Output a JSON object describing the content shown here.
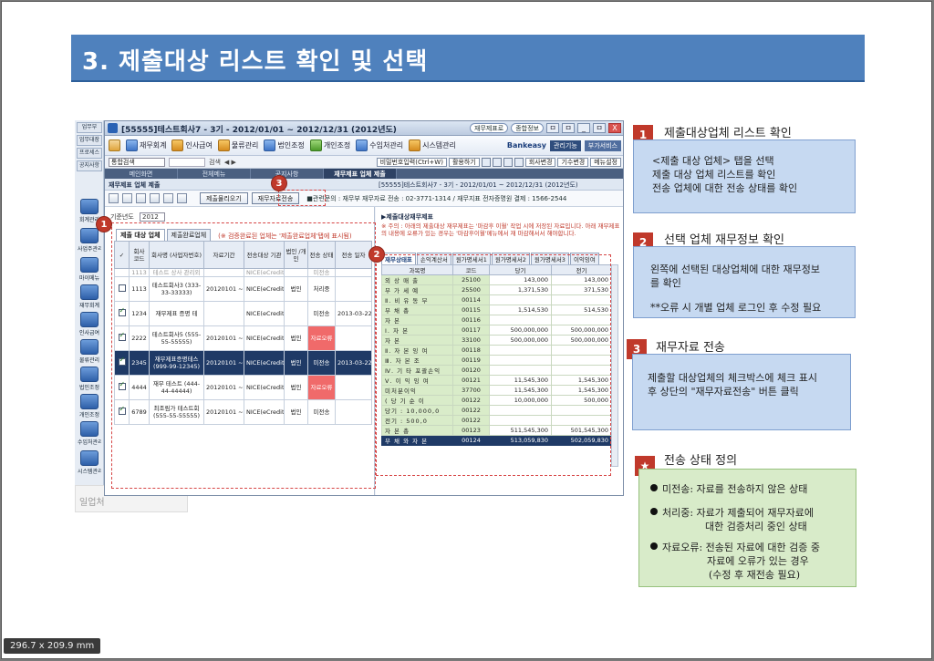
{
  "page_size_label": "296.7 x 209.9 mm",
  "title": "3. 제출대상 리스트 확인 및 선택",
  "app": {
    "window_title": "[55555]테스트회사7 - 3기 - 2012/01/01 ~ 2012/12/31 (2012년도)",
    "title_pills": [
      "재무제표로",
      "종합정보"
    ],
    "win_controls": [
      "ㅁ",
      "ㅁ",
      "_",
      "ㅁ",
      "X"
    ],
    "toolbar": {
      "items": [
        "재무회계",
        "인사급여",
        "물류관리",
        "법인조정",
        "개인조정",
        "수임처관리",
        "시스템관리"
      ],
      "brand": "Bankeasy",
      "drops": [
        "관리기능",
        "부가서비스"
      ]
    },
    "toolbar2": {
      "select_value": "통합검색",
      "search_label": "검색",
      "buttons": [
        "비밀번호입력(Ctrl+W)",
        "활용하기"
      ],
      "right_buttons": [
        "회사변경",
        "기수변경",
        "메뉴설정"
      ]
    },
    "menu_tabs": [
      "메인화면",
      "전체메뉴",
      "공지사항",
      "재무제표 업체 제출"
    ],
    "panel": {
      "title": "재무제표 업체 제출",
      "right_title": "[55555]테스트회사7 - 3기 - 2012/01/01 ~ 2012/12/31 (2012년도)"
    },
    "actions": {
      "btn_delete": "제출물리오기",
      "btn_send": "재무자료전송",
      "note": "■관련문의 : 재무부 재무자료 전송 : 02-3771-1314 / 재무지표 전자증명원 결제 : 1566-2544"
    },
    "left": {
      "year_label": "기준년도",
      "year_value": "2012",
      "tabs": [
        "제출 대상 업체",
        "제출완료업체"
      ],
      "tab_note": "(※ 검증완료된 업체는 '제출완료업체'탭에 표시됨)",
      "columns": [
        "✓",
        "회사 코드",
        "회사명 (사업자번호)",
        "자료기간",
        "전송대상 기관",
        "법인 /개인",
        "전송 상태",
        "전송 일자"
      ],
      "cut_row": [
        "",
        "1113",
        "테스트 상사 관리외",
        "",
        "NICE(eCredit",
        "",
        "미전송",
        ""
      ],
      "rows": [
        {
          "checked": false,
          "code": "1113",
          "name": "테스트회사3 (333-33-33333)",
          "period": "20120101 ~20121231",
          "agency": "NICE(eCredit",
          "type": "법인",
          "status": "처리중",
          "date": "",
          "status_err": false,
          "selected": false
        },
        {
          "checked": true,
          "code": "1234",
          "name": "재무제표 증명 테",
          "period": "",
          "agency": "NICE(eCredit",
          "type": "",
          "status": "미전송",
          "date": "2013-03-22",
          "status_err": false,
          "selected": false
        },
        {
          "checked": true,
          "code": "2222",
          "name": "테스트회사5 (555-55-55555)",
          "period": "20120101 ~20121231",
          "agency": "NICE(eCredit",
          "type": "법인",
          "status": "자료오류",
          "date": "",
          "status_err": true,
          "selected": false
        },
        {
          "checked": true,
          "code": "2345",
          "name": "재무제표증명테스 (999-99-12345)",
          "period": "20120101 ~20121231",
          "agency": "NICE(eCredit",
          "type": "법인",
          "status": "미전송",
          "date": "2013-03-22",
          "status_err": false,
          "selected": true
        },
        {
          "checked": true,
          "code": "4444",
          "name": "재무 테스트 (444-44-44444)",
          "period": "20120101 ~20121231",
          "agency": "NICE(eCredit",
          "type": "법인",
          "status": "자료오류",
          "date": "",
          "status_err": true,
          "selected": false
        },
        {
          "checked": true,
          "code": "6789",
          "name": "최조림가 테스트회 (555-55-55555)",
          "period": "20120101 ~20121231",
          "agency": "NICE(eCredit",
          "type": "법인",
          "status": "미전송",
          "date": "",
          "status_err": false,
          "selected": false
        }
      ]
    },
    "right": {
      "title": "▶제출대상재무제표",
      "note": "※ 주의 : 아래의 제출대상 재무제표는 '마감후 이월' 작업 시에 저장된 자료입니다. 아래 재무제표의 내용에 오류가 있는 경우는 '마감후이월'메뉴에서 재 마감해서서 해야합니다.",
      "tabs": [
        "재무상태표",
        "손익계산서",
        "원가명세서1",
        "원가명세서2",
        "원가명세서3",
        "이익잉여"
      ],
      "columns": [
        "과목명",
        "코드",
        "당기",
        "전기"
      ],
      "rows": [
        {
          "label": "외 상 매 출",
          "code": "25100",
          "cur": "143,000",
          "prev": "143,000"
        },
        {
          "label": "부 가 세 예",
          "code": "25500",
          "cur": "1,371,530",
          "prev": "371,530"
        },
        {
          "label": "Ⅱ. 비 유 동 부",
          "code": "00114",
          "cur": "",
          "prev": ""
        },
        {
          "label": "부 채 총",
          "code": "00115",
          "cur": "1,514,530",
          "prev": "514,530"
        },
        {
          "label": "자 본",
          "code": "00116",
          "cur": "",
          "prev": ""
        },
        {
          "label": "Ⅰ. 자 본",
          "code": "00117",
          "cur": "500,000,000",
          "prev": "500,000,000"
        },
        {
          "label": "자 본",
          "code": "33100",
          "cur": "500,000,000",
          "prev": "500,000,000"
        },
        {
          "label": "Ⅱ. 자 본 잉 여",
          "code": "00118",
          "cur": "",
          "prev": ""
        },
        {
          "label": "Ⅲ. 자 본 조",
          "code": "00119",
          "cur": "",
          "prev": ""
        },
        {
          "label": "Ⅳ. 기 타 포괄손익",
          "code": "00120",
          "cur": "",
          "prev": ""
        },
        {
          "label": "Ⅴ. 이 익 잉 여",
          "code": "00121",
          "cur": "11,545,300",
          "prev": "1,545,300"
        },
        {
          "label": "미처분이익",
          "code": "37700",
          "cur": "11,545,300",
          "prev": "1,545,300"
        },
        {
          "label": "( 당 기 순 이",
          "code": "00122",
          "cur": "10,000,000",
          "prev": "500,000"
        },
        {
          "label": "당기 : 10,000,0",
          "code": "00122",
          "cur": "",
          "prev": ""
        },
        {
          "label": "전기 : 500,0",
          "code": "00122",
          "cur": "",
          "prev": ""
        },
        {
          "label": "자 본 총",
          "code": "00123",
          "cur": "511,545,300",
          "prev": "501,545,300"
        },
        {
          "label": "부 채 와 자 본",
          "code": "00124",
          "cur": "513,059,830",
          "prev": "502,059,830",
          "selected": true
        }
      ]
    },
    "strip": {
      "tabs": [
        "업무부",
        "업무대장",
        "프로세스",
        "공지사항"
      ],
      "items": [
        "회계관리",
        "사업주관리",
        "마이메뉴",
        "재무회계",
        "인사급여",
        "물류관리",
        "법인조정",
        "개인조정",
        "수임처관리",
        "시스템관리"
      ],
      "footer": "일업처"
    }
  },
  "badges": [
    "1",
    "2",
    "3"
  ],
  "callouts": [
    {
      "num": "1",
      "heading": "제출대상업체 리스트 확인",
      "lines": [
        "<제출 대상 업체> 탭을 선택",
        "제출 대상 업체 리스트를 확인",
        "전송 업체에 대한 전송 상태를 확인"
      ]
    },
    {
      "num": "2",
      "heading": "선택 업체 재무정보 확인",
      "lines": [
        "왼쪽에 선택된 대상업체에 대한 재무정보",
        "를 확인",
        "",
        "**오류 시 개별 업체 로그인 후 수정 필요"
      ]
    },
    {
      "num": "3",
      "heading": "재무자료 전송",
      "lines": [
        "제출할 대상업체의 체크박스에 체크 표시",
        "후 상단의 \"재무자료전송\" 버튼 클릭"
      ]
    }
  ],
  "legend": {
    "star": "★",
    "heading": "전송 상태 정의",
    "items": [
      {
        "lines": [
          "미전송: 자료를 전송하지 않은 상태"
        ]
      },
      {
        "lines": [
          "처리중: 자료가 제출되어 재무자료에",
          "대한 검증처리 중인 상태"
        ]
      },
      {
        "lines": [
          "자료오류: 전송된 자료에 대한 검증 중",
          "자료에 오류가 있는 경우",
          "(수정 후 재전송 필요)"
        ]
      }
    ]
  }
}
